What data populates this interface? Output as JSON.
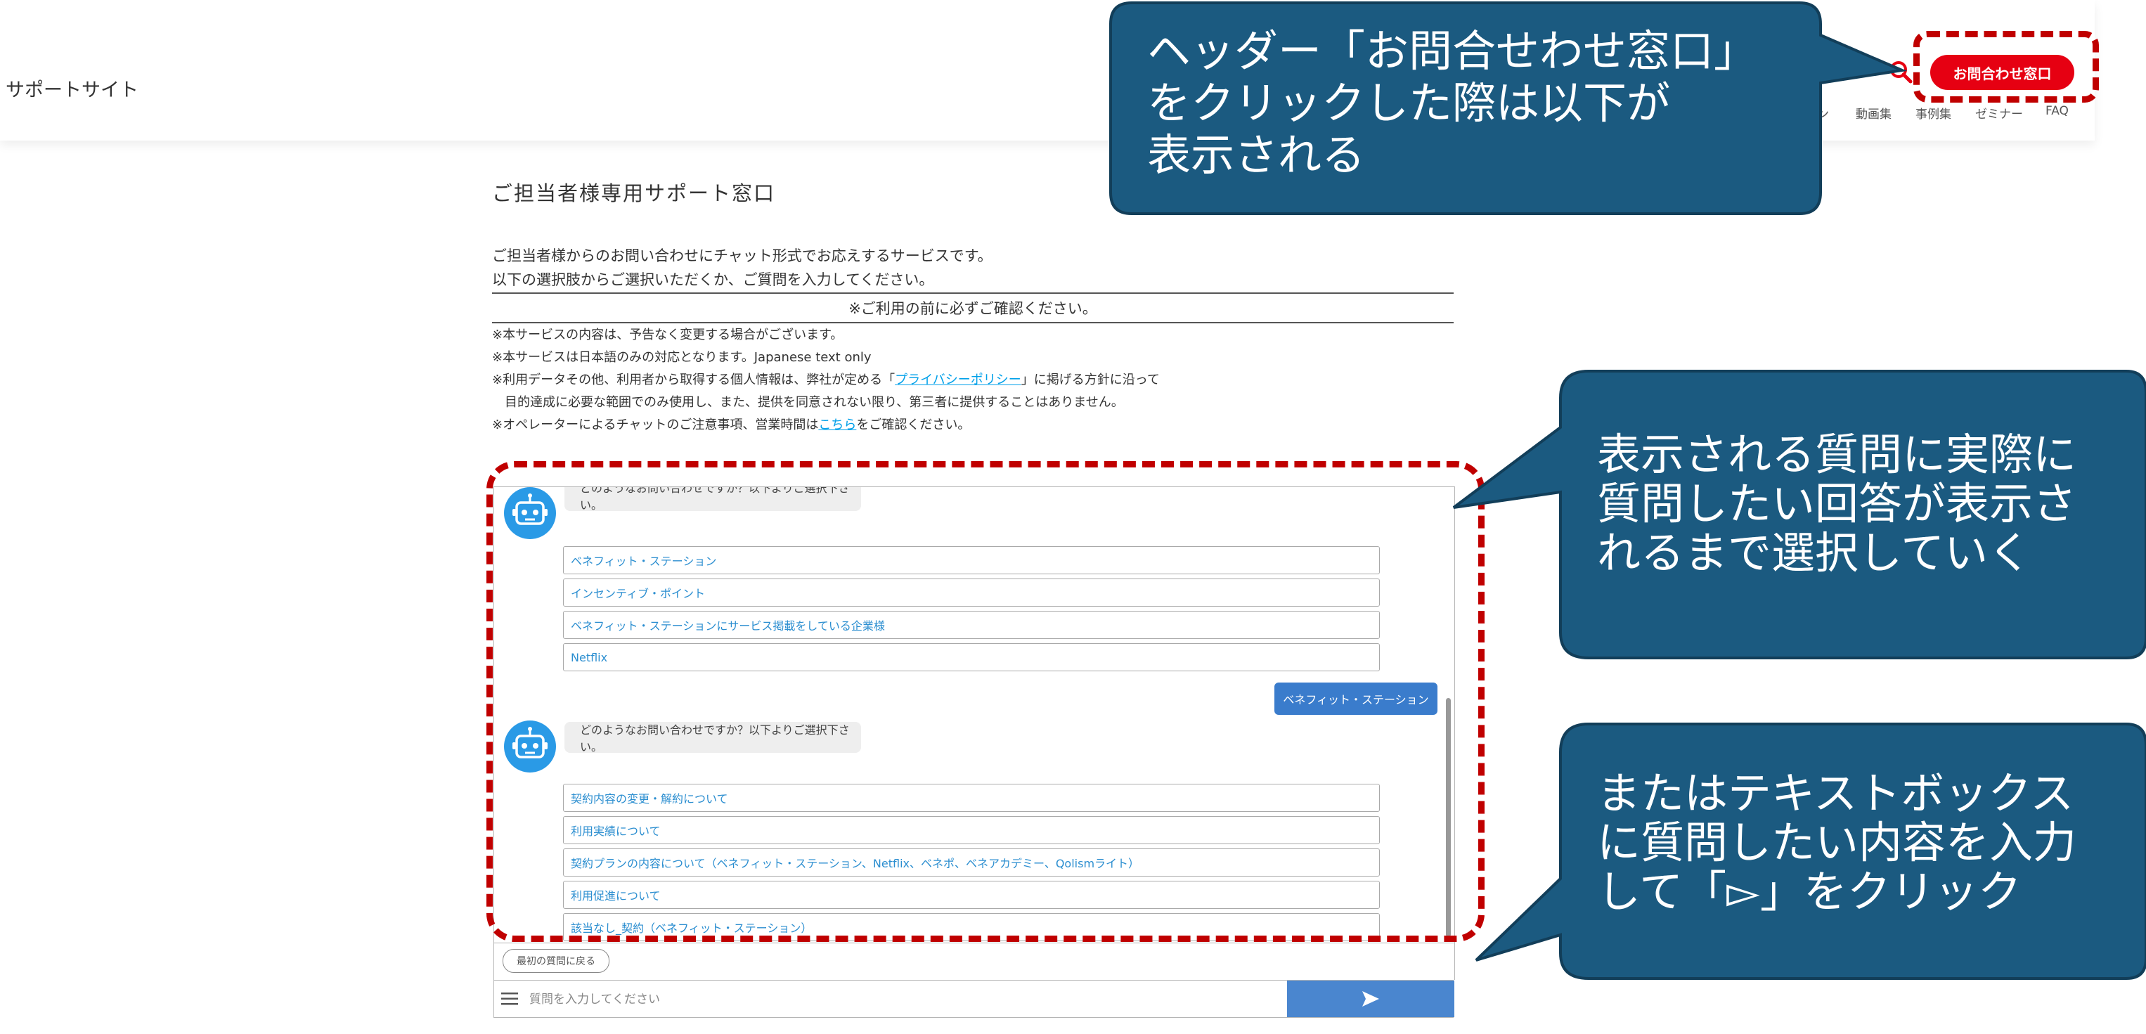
{
  "header": {
    "site_name": "サポートサイト",
    "contact_button": "お問合わせ窓口",
    "nav": [
      "ン",
      "動画集",
      "事例集",
      "ゼミナー",
      "FAQ"
    ]
  },
  "main": {
    "title": "ご担当者様専用サポート窓口",
    "intro": [
      "ご担当者様からのお問い合わせにチャット形式でお応えするサービスです。",
      "以下の選択肢からご選択いただくか、ご質問を入力してください。"
    ],
    "notice_heading": "※ご利用の前に必ずご確認ください。",
    "notes": {
      "n1": "※本サービスの内容は、予告なく変更する場合がございます。",
      "n2": "※本サービスは日本語のみの対応となります。Japanese text only",
      "n3_pre": "※利用データその他、利用者から取得する個人情報は、弊社が定める「",
      "n3_link": "プライバシーポリシー",
      "n3_post": "」に掲げる方針に沿って",
      "n4": "目的達成に必要な範囲でのみ使用し、また、提供を同意されない限り、第三者に提供することはありません。",
      "n5_pre": "※オペレーターによるチャットのご注意事項、営業時間は",
      "n5_link": "こちら",
      "n5_post": "をご確認ください。"
    }
  },
  "chat": {
    "bot_message_1": "どのようなお問い合わせですか？以下よりご選択下さい。",
    "options_1": [
      "ベネフィット・ステーション",
      "インセンティブ・ポイント",
      "ベネフィット・ステーションにサービス掲載をしている企業様",
      "Netflix"
    ],
    "user_reply": "ベネフィット・ステーション",
    "bot_message_2": "どのようなお問い合わせですか？以下よりご選択下さい。",
    "options_2": [
      "契約内容の変更・解約について",
      "利用実績について",
      "契約プランの内容について（ベネフィット・ステーション、Netflix、ベネポ、ベネアカデミー、Qolismライト）",
      "利用促進について",
      "該当なし_契約（ベネフィット・ステーション）"
    ],
    "back_button": "最初の質問に戻る",
    "input_placeholder": "質問を入力してください"
  },
  "callouts": {
    "c1": "ヘッダー「お問合せわせ窓口」\nをクリックした際は以下が\n表示される",
    "c2": "表示される質問に実際に\n質問したい回答が表示さ\nれるまで選択していく",
    "c3": "またはテキストボックス\nに質問したい内容を入力\nして「▻」をクリック"
  },
  "colors": {
    "brand_red": "#e60012",
    "callout_fill": "#1b5a80",
    "annotation_red": "#c00000",
    "send_blue": "#4a86cf"
  }
}
